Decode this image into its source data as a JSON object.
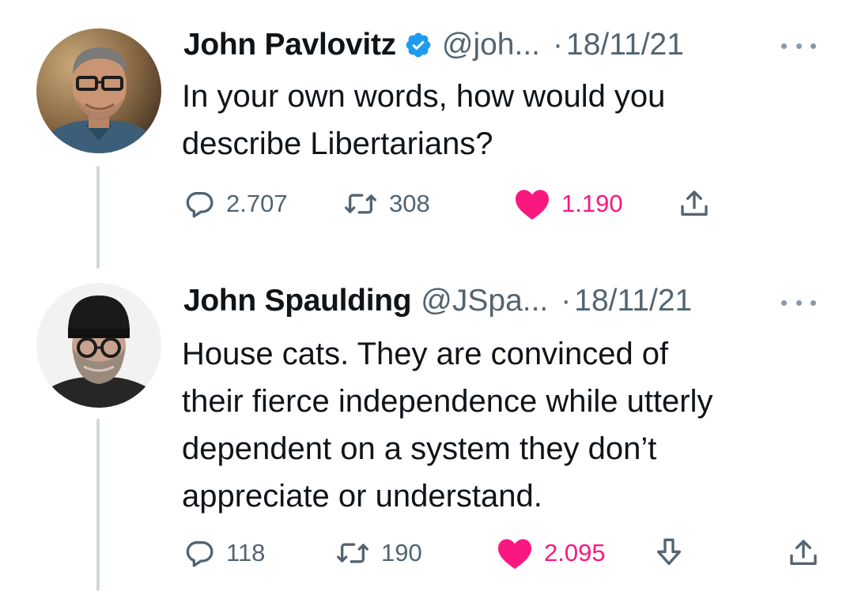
{
  "tweets": [
    {
      "name": "John Pavlovitz",
      "verified": true,
      "handle": "@joh...",
      "separator": "·",
      "date": "18/11/21",
      "text_lines": [
        "In your own words, how would you",
        "describe Libertarians?"
      ],
      "replies": "2.707",
      "retweets": "308",
      "likes": "1.190",
      "liked": true
    },
    {
      "name": "John Spaulding",
      "verified": false,
      "handle": "@JSpa...",
      "separator": "·",
      "date": "18/11/21",
      "text_lines": [
        "House cats. They are convinced of",
        "their fierce independence while utterly",
        "dependent on a system they don’t",
        "appreciate or understand."
      ],
      "replies": "118",
      "retweets": "190",
      "likes": "2.095",
      "liked": true
    }
  ],
  "colors": {
    "text": "#0f1419",
    "secondary": "#536471",
    "like": "#f91880",
    "verified": "#1d9bf0",
    "thread_line": "#cfd9de"
  },
  "icons": {
    "reply": "speech-bubble-icon",
    "retweet": "retweet-arrows-icon",
    "like": "heart-icon",
    "share": "share-upload-icon",
    "download": "download-arrow-icon",
    "more": "ellipsis-icon",
    "verified": "verified-badge-icon"
  }
}
